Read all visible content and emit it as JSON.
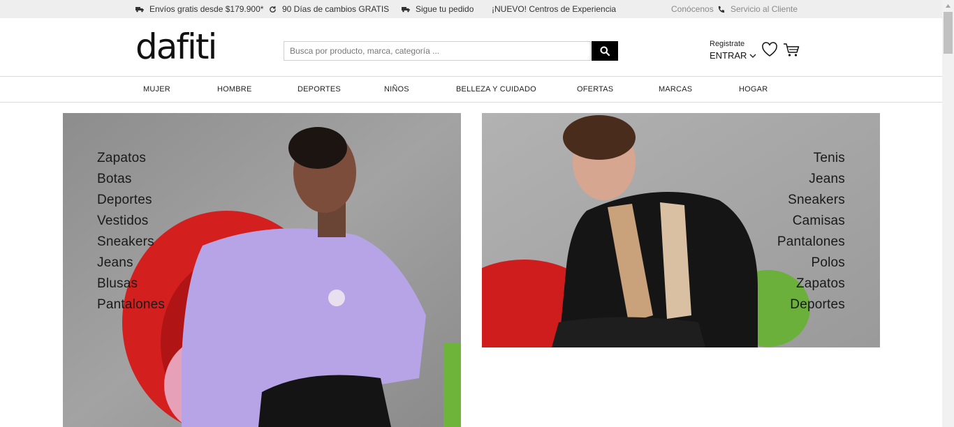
{
  "topbar": {
    "shipping": "Envíos gratis desde $179.900*",
    "returns": "90 Días de cambios GRATIS",
    "track": "Sigue tu pedido",
    "experience": "¡NUEVO! Centros de Experiencia",
    "about": "Conócenos",
    "service": "Servicio al Cliente"
  },
  "header": {
    "logo": "dafiti",
    "search_placeholder": "Busca por producto, marca, categoría ...",
    "register": "Registrate",
    "login": "ENTRAR"
  },
  "nav": [
    "MUJER",
    "HOMBRE",
    "DEPORTES",
    "NIÑOS",
    "BELLEZA Y CUIDADO",
    "OFERTAS",
    "MARCAS",
    "HOGAR"
  ],
  "banners": {
    "women": [
      "Zapatos",
      "Botas",
      "Deportes",
      "Vestidos",
      "Sneakers",
      "Jeans",
      "Blusas",
      "Pantalones"
    ],
    "men": [
      "Tenis",
      "Jeans",
      "Sneakers",
      "Camisas",
      "Pantalones",
      "Polos",
      "Zapatos",
      "Deportes"
    ]
  },
  "icons": {
    "shipping": "truck-icon",
    "returns": "refresh-icon",
    "track": "truck-icon",
    "service": "phone-icon",
    "search": "search-icon",
    "wishlist": "heart-icon",
    "cart": "cart-icon",
    "login": "chevron-down-icon"
  },
  "colors": {
    "topbar_bg": "#eeeeee",
    "search_button": "#000000",
    "text": "#222222"
  }
}
